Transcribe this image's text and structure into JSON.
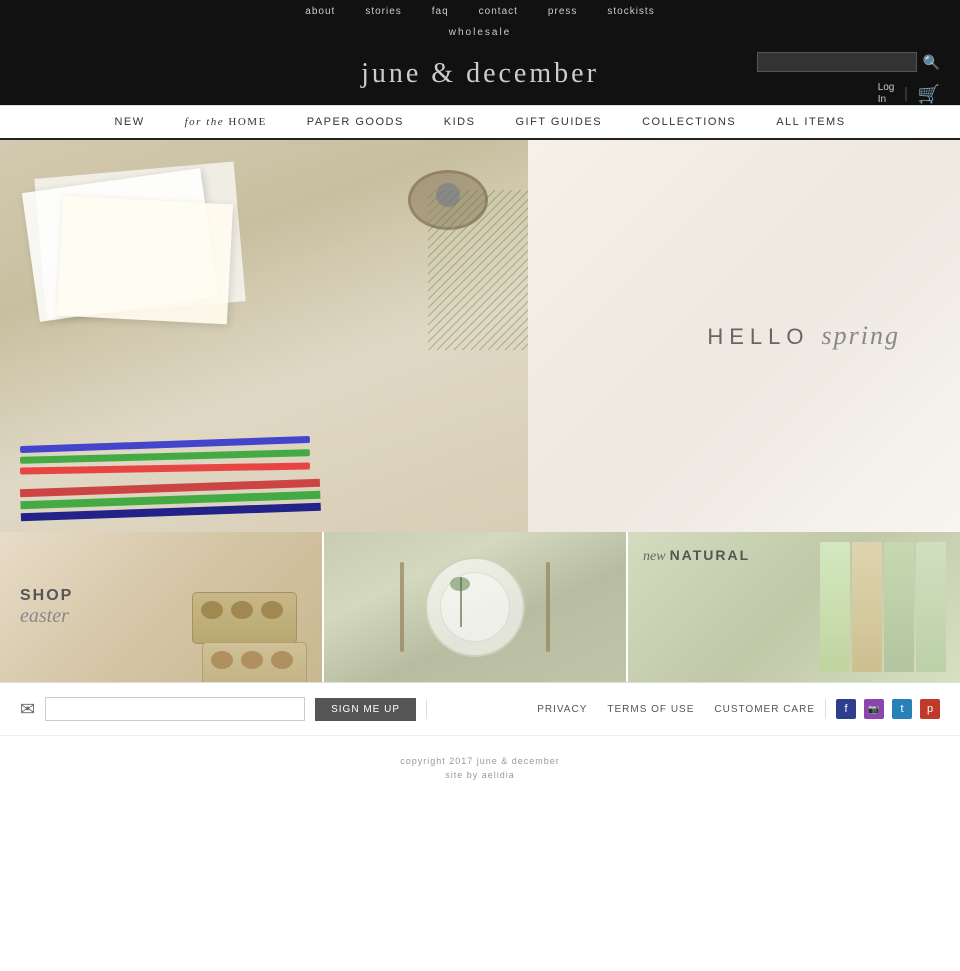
{
  "site": {
    "title": "june & december"
  },
  "top_nav": {
    "items": [
      {
        "label": "about",
        "href": "#"
      },
      {
        "label": "stories",
        "href": "#"
      },
      {
        "label": "FAQ",
        "href": "#"
      },
      {
        "label": "contact",
        "href": "#"
      },
      {
        "label": "press",
        "href": "#"
      },
      {
        "label": "stockists",
        "href": "#"
      }
    ],
    "wholesale_label": "wholesale"
  },
  "header": {
    "search_placeholder": "",
    "login_label": "Log",
    "login_label2": "In",
    "cart_icon": "🛒"
  },
  "main_nav": {
    "items": [
      {
        "label": "NEW",
        "style": "normal"
      },
      {
        "label": "for the HOME",
        "style": "mixed"
      },
      {
        "label": "PAPER GOODS",
        "style": "normal"
      },
      {
        "label": "KIDS",
        "style": "normal"
      },
      {
        "label": "GIFT GUIDES",
        "style": "normal"
      },
      {
        "label": "COLLECTIONS",
        "style": "normal"
      },
      {
        "label": "ALL ITEMS",
        "style": "normal"
      }
    ]
  },
  "hero": {
    "text_hello": "HELLO",
    "text_spring": "spring"
  },
  "panels": [
    {
      "id": "easter",
      "shop_label": "SHOP",
      "category_label": "easter"
    },
    {
      "id": "table",
      "label": ""
    },
    {
      "id": "natural",
      "new_label": "new",
      "natural_label": "NATURAL"
    }
  ],
  "footer": {
    "email_placeholder": "",
    "signup_button": "SIGN ME UP",
    "links": [
      {
        "label": "PRIVACY"
      },
      {
        "label": "TERMS OF USE"
      },
      {
        "label": "CUSTOMER CARE"
      }
    ],
    "social": [
      {
        "name": "facebook",
        "symbol": "f"
      },
      {
        "name": "instagram",
        "symbol": "📷"
      },
      {
        "name": "twitter",
        "symbol": "t"
      },
      {
        "name": "pinterest",
        "symbol": "p"
      }
    ],
    "copyright": "copyright 2017 june & december",
    "site_by": "site by aelidia"
  }
}
